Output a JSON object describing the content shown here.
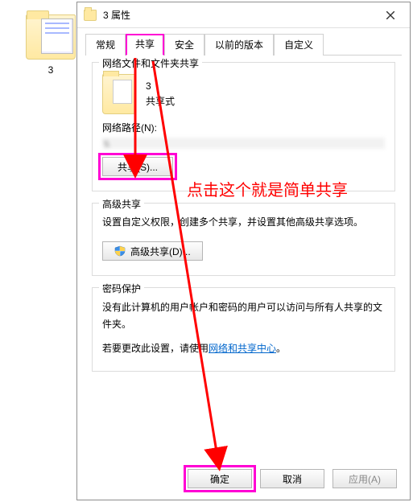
{
  "desktop": {
    "folder_label": "3"
  },
  "dialog": {
    "title": "3 属性",
    "tabs": {
      "general": "常规",
      "share": "共享",
      "security": "安全",
      "previous": "以前的版本",
      "custom": "自定义"
    },
    "share_group": {
      "legend": "网络文件和文件夹共享",
      "folder_name": "3",
      "folder_state": "共享式",
      "net_path_label": "网络路径(N):",
      "net_path_value": "\\\\",
      "share_btn": "共享(S)..."
    },
    "adv_group": {
      "legend": "高级共享",
      "desc": "设置自定义权限，创建多个共享，并设置其他高级共享选项。",
      "btn": "高级共享(D)..."
    },
    "pwd_group": {
      "legend": "密码保护",
      "desc1": "没有此计算机的用户帐户和密码的用户可以访问与所有人共享的文件夹。",
      "desc2_prefix": "若要更改此设置，请使用",
      "desc2_link": "网络和共享中心",
      "desc2_suffix": "。"
    },
    "footer": {
      "ok": "确定",
      "cancel": "取消",
      "apply": "应用(A)"
    }
  },
  "annotations": {
    "callout": "点击这个就是简单共享"
  }
}
